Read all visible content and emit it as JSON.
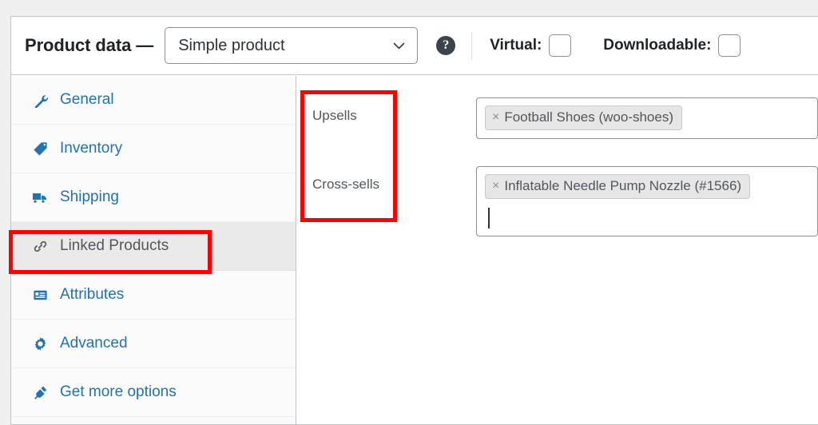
{
  "header": {
    "title": "Product data —",
    "product_type": {
      "selected": "Simple product",
      "icon": "chevron-down-icon"
    },
    "help_icon": "help-circle-icon",
    "help_glyph": "?",
    "toggles": [
      {
        "label": "Virtual:",
        "checked": false
      },
      {
        "label": "Downloadable:",
        "checked": false
      }
    ]
  },
  "sidebar": {
    "items": [
      {
        "label": "General",
        "icon": "wrench-icon",
        "active": false
      },
      {
        "label": "Inventory",
        "icon": "tag-icon",
        "active": false
      },
      {
        "label": "Shipping",
        "icon": "truck-icon",
        "active": false
      },
      {
        "label": "Linked Products",
        "icon": "link-icon",
        "active": true
      },
      {
        "label": "Attributes",
        "icon": "list-view-icon",
        "active": false
      },
      {
        "label": "Advanced",
        "icon": "gear-icon",
        "active": false
      },
      {
        "label": "Get more options",
        "icon": "plugin-icon",
        "active": false
      }
    ]
  },
  "content": {
    "fields": [
      {
        "label": "Upsells",
        "tokens": [
          {
            "remove": "×",
            "text": "Football Shoes (woo-shoes)"
          }
        ],
        "has_caret": false
      },
      {
        "label": "Cross-sells",
        "tokens": [
          {
            "remove": "×",
            "text": "Inflatable Needle Pump Nozzle (#1566)"
          }
        ],
        "has_caret": true
      }
    ]
  },
  "annotations": {
    "boxes": [
      {
        "name": "linked-products-highlight",
        "color": "#ff0000"
      },
      {
        "name": "upsells-crosssells-highlight",
        "color": "#ff0000"
      }
    ]
  }
}
